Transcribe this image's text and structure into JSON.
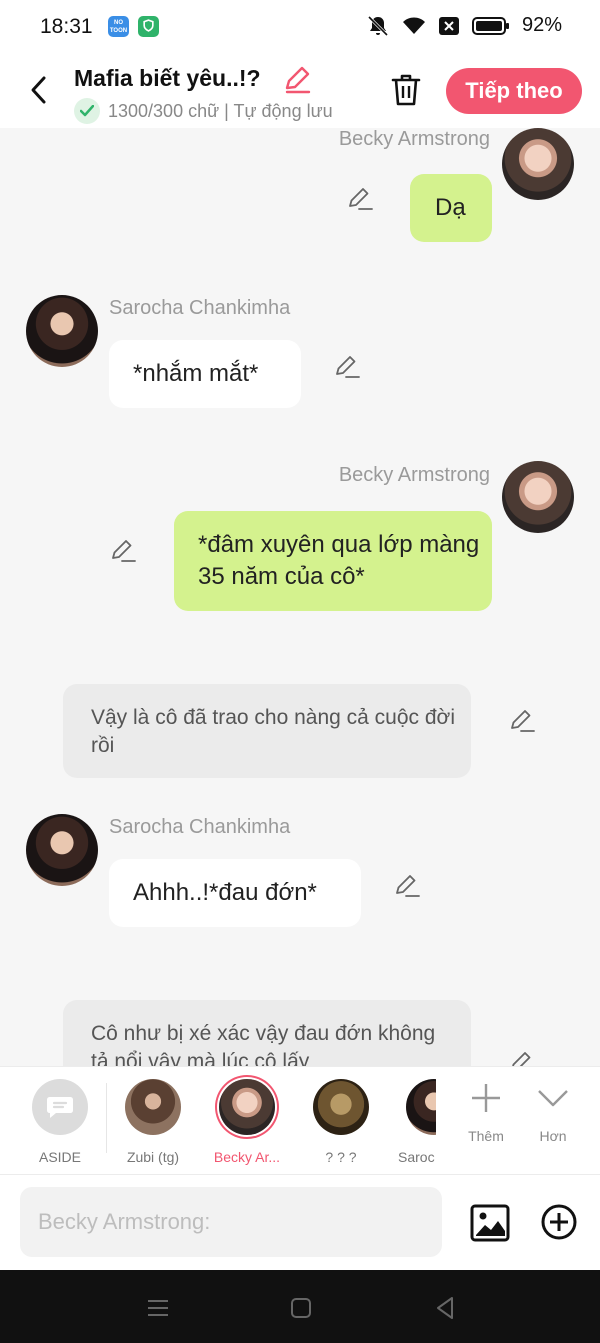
{
  "status_bar": {
    "time": "18:31",
    "battery": "92%",
    "app_icons": [
      "NOVEL TOON",
      "shield-app"
    ]
  },
  "header": {
    "title": "Mafia biết yêu..!?",
    "subtitle": "1300/300 chữ | Tự động lưu",
    "next_label": "Tiếp theo",
    "accent": "#f25670"
  },
  "messages": [
    {
      "sender": "Becky Armstrong",
      "text": "Dạ",
      "side": "right",
      "style": "green"
    },
    {
      "sender": "Sarocha Chankimha",
      "text": "*nhắm mắt*",
      "side": "left",
      "style": "white"
    },
    {
      "sender": "Becky Armstrong",
      "text": "*đâm xuyên qua lớp màng 35 năm của cô*",
      "side": "right",
      "style": "green"
    },
    {
      "sender": "",
      "text": "Vậy là cô đã trao cho nàng cả cuộc đời rồi",
      "side": "center",
      "style": "aside"
    },
    {
      "sender": "Sarocha Chankimha",
      "text": "Ahhh..!*đau đớn*",
      "side": "left",
      "style": "white"
    },
    {
      "sender": "",
      "text": "Cô như bị xé xác vậy đau đớn không tả nổi vậy mà lúc cô lấy",
      "side": "center",
      "style": "aside"
    }
  ],
  "characters": [
    {
      "label": "ASIDE"
    },
    {
      "label": "Zubi (tg)"
    },
    {
      "label": "Becky Ar...",
      "active": true
    },
    {
      "label": "? ? ?"
    },
    {
      "label": "Saroc"
    }
  ],
  "tools": {
    "add_label": "Thêm",
    "more_label": "Hơn"
  },
  "input": {
    "placeholder": "Becky Armstrong:"
  },
  "colors": {
    "bubble_green": "#d4f28e",
    "bubble_gray": "#ebebeb",
    "accent": "#f25670"
  }
}
